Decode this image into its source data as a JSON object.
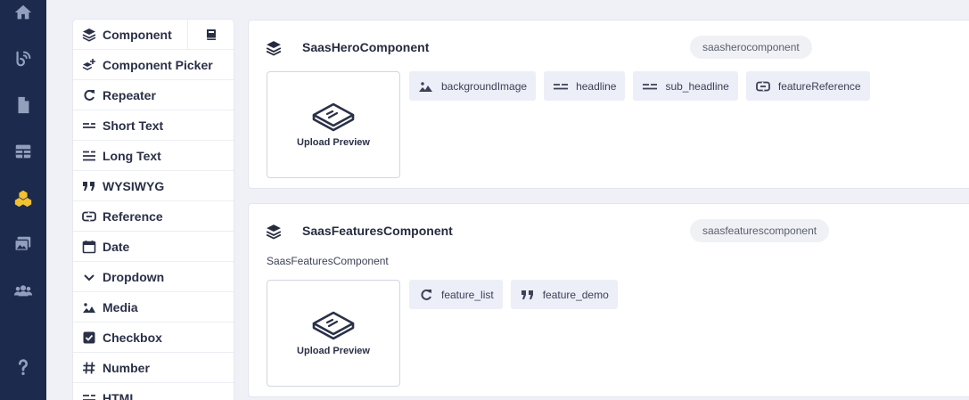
{
  "rail": {
    "items": [
      {
        "name": "home-icon"
      },
      {
        "name": "blog-icon"
      },
      {
        "name": "page-icon"
      },
      {
        "name": "table-icon"
      },
      {
        "name": "components-icon",
        "active": true
      },
      {
        "name": "media-icon"
      },
      {
        "name": "users-icon"
      },
      {
        "name": "help-icon"
      }
    ],
    "colors": {
      "background": "#1c2a4d",
      "icon": "#93a0bd",
      "active": "#f2c230"
    }
  },
  "palette": {
    "items": [
      {
        "label": "Component",
        "icon": "layers-icon"
      },
      {
        "label": "Component Picker",
        "icon": "layers-plus-icon"
      },
      {
        "label": "Repeater",
        "icon": "repeat-icon"
      },
      {
        "label": "Short Text",
        "icon": "short-text-icon"
      },
      {
        "label": "Long Text",
        "icon": "long-text-icon"
      },
      {
        "label": "WYSIWYG",
        "icon": "quote-icon"
      },
      {
        "label": "Reference",
        "icon": "link-icon"
      },
      {
        "label": "Date",
        "icon": "calendar-icon"
      },
      {
        "label": "Dropdown",
        "icon": "chevron-down-icon"
      },
      {
        "label": "Media",
        "icon": "image-icon"
      },
      {
        "label": "Checkbox",
        "icon": "checkbox-icon"
      },
      {
        "label": "Number",
        "icon": "hash-icon"
      },
      {
        "label": "HTML",
        "icon": "html-icon"
      }
    ],
    "book_icon": "book-icon"
  },
  "cards": [
    {
      "title": "SaasHeroComponent",
      "badge": "saasherocomponent",
      "subtitle": "",
      "upload_label": "Upload Preview",
      "fields": [
        {
          "label": "backgroundImage",
          "icon": "image-icon"
        },
        {
          "label": "headline",
          "icon": "short-text-icon"
        },
        {
          "label": "sub_headline",
          "icon": "short-text-icon"
        },
        {
          "label": "featureReference",
          "icon": "link-icon"
        }
      ]
    },
    {
      "title": "SaasFeaturesComponent",
      "badge": "saasfeaturescomponent",
      "subtitle": "SaasFeaturesComponent",
      "upload_label": "Upload Preview",
      "fields": [
        {
          "label": "feature_list",
          "icon": "repeat-icon"
        },
        {
          "label": "feature_demo",
          "icon": "quote-icon"
        }
      ]
    }
  ]
}
